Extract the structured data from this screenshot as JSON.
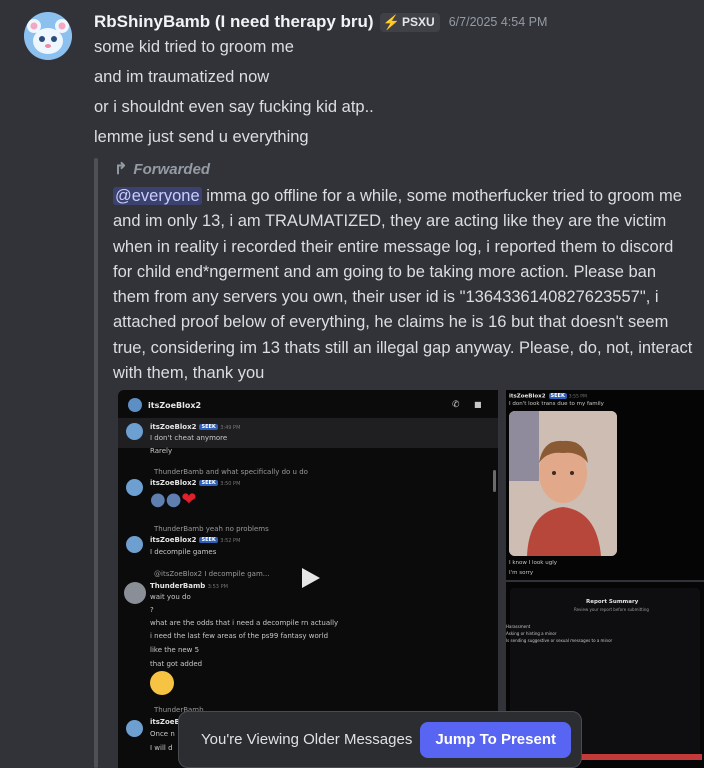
{
  "message": {
    "username": "RbShinyBamb (I need therapy bru)",
    "tag": "PSXU",
    "timestamp": "6/7/2025 4:54 PM",
    "lines": [
      "some kid tried to groom me",
      "and im traumatized now",
      "or i shouldnt even say fucking kid atp..",
      "lemme just send u everything"
    ]
  },
  "forward": {
    "label": "Forwarded",
    "mention": "@everyone",
    "text": " imma go offline for a while, some motherfucker tried to groom me and im only 13, i am TRAUMATIZED, they are acting like they are the victim when  in reality i recorded their entire message log, i reported them to discord for child end*ngerment and am going to be taking more action. Please ban them from any servers you own, their user id is \"1364336140827623557\", i attached proof below of everything, he claims he is 16 but that doesn't seem true, considering im 13 thats still an illegal gap anyway. Please, do, not, interact with them, thank you"
  },
  "attachment1": {
    "dm_title": "itsZoeBlox2",
    "badge": "SEEK",
    "rows": [
      {
        "name": "itsZoeBlox2",
        "time": "3:49 PM",
        "lines": [
          "I don't cheat anymore",
          "Rarely"
        ]
      },
      {
        "name": "itsZoeBlox2",
        "time": "3:50 PM",
        "reply": "ThunderBamb and what specifically do u do",
        "lines": []
      },
      {
        "name": "itsZoeBlox2",
        "time": "3:52 PM",
        "reply": "ThunderBamb yeah no problems",
        "lines": [
          "I decompile games"
        ]
      },
      {
        "name": "ThunderBamb",
        "time": "3:53 PM",
        "reply": "@itsZoeBlox2  I decompile gam...",
        "lines": [
          "wait you do",
          "?",
          "what are the odds that i need a decompile rn actually",
          "i need the last few areas of the ps99 fantasy world",
          "like the new 5",
          "that got added"
        ]
      },
      {
        "name": "itsZoeB",
        "time": "",
        "reply": "ThunderBamb",
        "lines": [
          "Once n",
          "I will d"
        ]
      }
    ]
  },
  "attachment2": {
    "name": "itsZoeBlox2",
    "badge": "SEEK",
    "time": "3:55 PM",
    "caption_top": "I don't look trans due to my family",
    "caption_1": "I know I look ugly",
    "caption_2": "I'm sorry"
  },
  "attachment3": {
    "title": "Report Summary",
    "subtitle": "Review your report before submitting",
    "items": [
      "Harassment",
      "Asking or hinting a minor",
      "Is sending suggestive or sexual messages to a minor"
    ]
  },
  "banner": {
    "text": "You're Viewing Older Messages",
    "button": "Jump To Present"
  },
  "colors": {
    "background": "#323339",
    "accent": "#5865f2",
    "mention_bg": "#3c4270"
  }
}
